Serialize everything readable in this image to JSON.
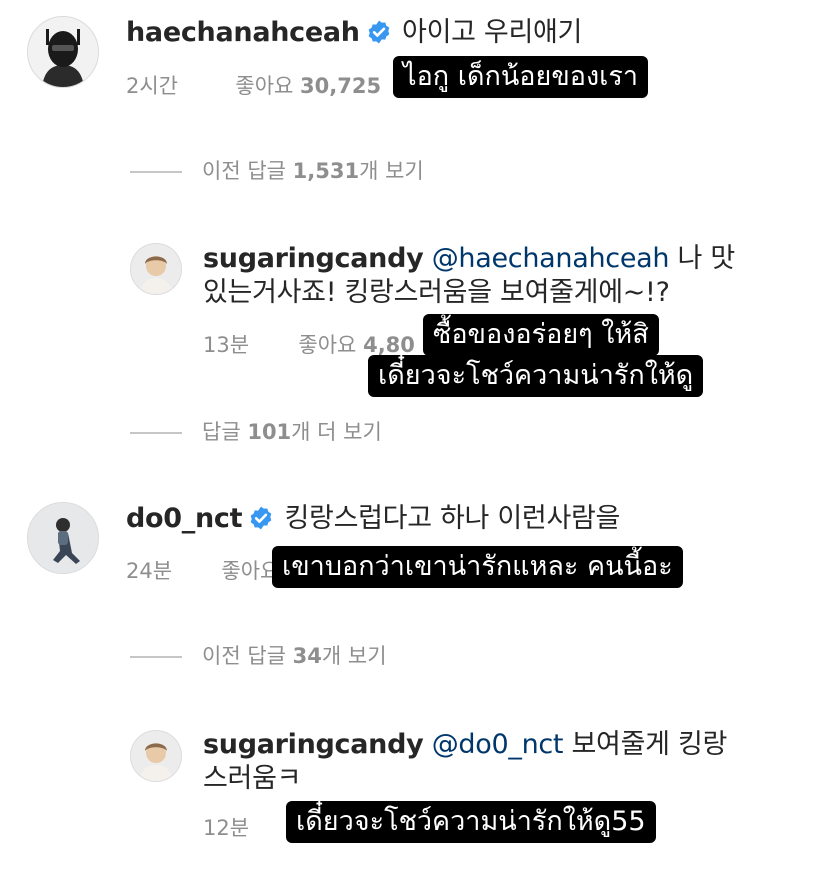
{
  "comments": [
    {
      "username": "haechanahceah",
      "verified": true,
      "mention": "",
      "text": "아이고 우리애기",
      "time": "2시간",
      "likes_label": "좋아요",
      "likes_count": "30,725",
      "subtitle": "ไอกู เด็กน้อยของเรา",
      "avatar_icon": "helmet-avatar"
    },
    {
      "username": "sugaringcandy",
      "verified": false,
      "mention": "@haechanahceah",
      "text_line1": "나 맛",
      "text_line2": "있는거사죠! 킹랑스러움을 보여줄게에~!?",
      "time": "13분",
      "likes_label": "좋아요",
      "likes_count": "4,80",
      "subtitle_line1": "ซื้อของอร่อยๆ ให้สิ",
      "subtitle_line2": "เดี๋ยวจะโชว์ความน่ารักให้ดู",
      "avatar_icon": "person-avatar"
    },
    {
      "username": "do0_nct",
      "verified": true,
      "mention": "",
      "text": "킹랑스럽다고 하나 이런사람을",
      "time": "24분",
      "likes_label": "좋아요",
      "subtitle": "เขาบอกว่าเขาน่ารักแหละ คนนี้อะ",
      "avatar_icon": "person-sitting-avatar"
    },
    {
      "username": "sugaringcandy",
      "verified": false,
      "mention": "@do0_nct",
      "text_line1": "보여줄게 킹랑",
      "text_line2": "스러움ㅋ",
      "time": "12분",
      "subtitle": "เดี๋ยวจะโชว์ความน่ารักให้ดู55",
      "avatar_icon": "person-avatar"
    }
  ],
  "reply_toggles": [
    {
      "prefix": "이전 답글 ",
      "count": "1,531",
      "suffix": "개 보기"
    },
    {
      "prefix": "답글 ",
      "count": "101",
      "suffix": "개 더 보기"
    },
    {
      "prefix": "이전 답글 ",
      "count": "34",
      "suffix": "개 보기"
    }
  ],
  "colors": {
    "verified": "#3897f0",
    "mention": "#00376b",
    "meta": "#8e8e8e",
    "subtitle_bg": "#000000"
  }
}
